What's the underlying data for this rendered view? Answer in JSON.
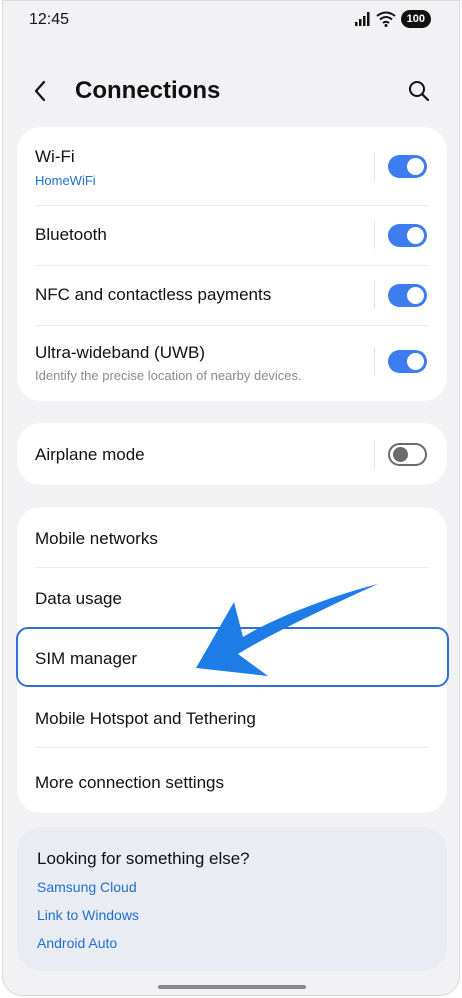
{
  "status": {
    "time": "12:45",
    "battery": "100"
  },
  "header": {
    "title": "Connections"
  },
  "toggles_card": [
    {
      "label": "Wi-Fi",
      "sub": "HomeWiFi",
      "on": true
    },
    {
      "label": "Bluetooth",
      "on": true
    },
    {
      "label": "NFC and contactless payments",
      "on": true
    },
    {
      "label": "Ultra-wideband (UWB)",
      "sub": "Identify the precise location of nearby devices.",
      "on": true
    }
  ],
  "airplane": {
    "label": "Airplane mode",
    "on": false
  },
  "menu_card": [
    {
      "label": "Mobile networks"
    },
    {
      "label": "Data usage"
    },
    {
      "label": "SIM manager"
    },
    {
      "label": "Mobile Hotspot and Tethering"
    },
    {
      "label": "More connection settings"
    }
  ],
  "footer": {
    "heading": "Looking for something else?",
    "links": [
      "Samsung Cloud",
      "Link to Windows",
      "Android Auto"
    ]
  },
  "colors": {
    "accent": "#3e7df0",
    "link": "#1f6fd1",
    "highlight": "#2e6fdc"
  },
  "icons": [
    "signal-icon",
    "wifi-icon",
    "back-icon",
    "search-icon",
    "pointer-arrow-icon"
  ]
}
